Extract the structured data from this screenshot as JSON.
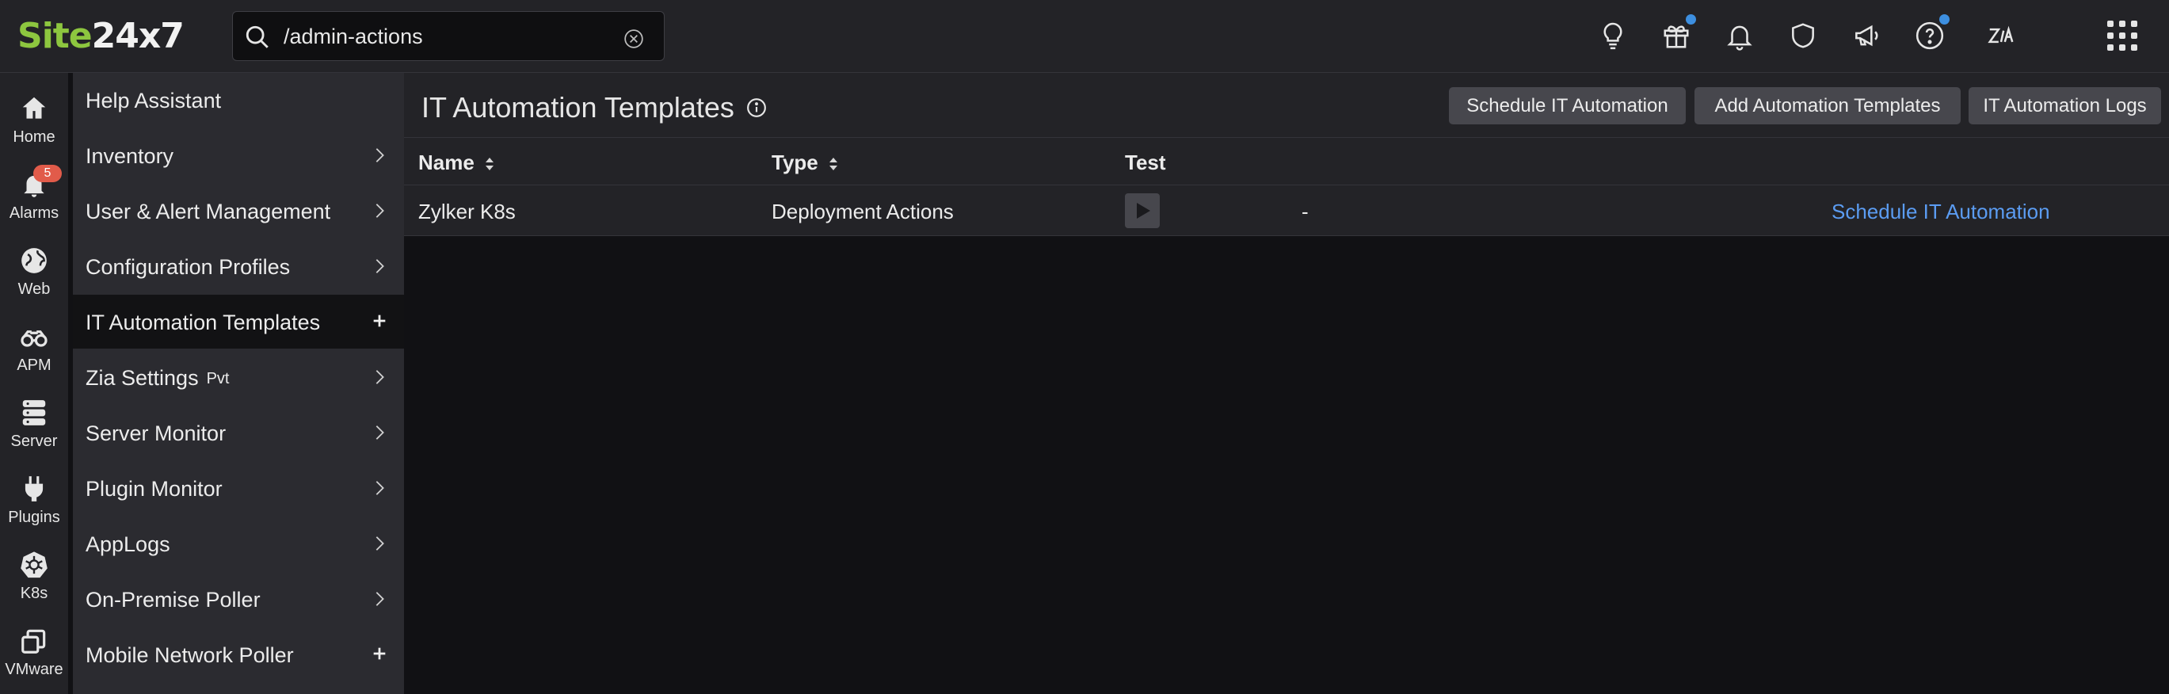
{
  "logo": {
    "part1": "Site",
    "part2": "24x7"
  },
  "search": {
    "value": "/admin-actions"
  },
  "topbar_icons": [
    "lightbulb-icon",
    "gift-icon",
    "bell-icon",
    "shield-icon",
    "megaphone-icon",
    "help-icon",
    "zia-icon",
    "apps-grid-icon"
  ],
  "rail": [
    {
      "label": "Home",
      "icon": "home-icon"
    },
    {
      "label": "Alarms",
      "icon": "alarm-bell-icon",
      "badge": "5"
    },
    {
      "label": "Web",
      "icon": "globe-icon"
    },
    {
      "label": "APM",
      "icon": "binoculars-icon"
    },
    {
      "label": "Server",
      "icon": "server-icon"
    },
    {
      "label": "Plugins",
      "icon": "plug-icon"
    },
    {
      "label": "K8s",
      "icon": "kubernetes-icon"
    },
    {
      "label": "VMware",
      "icon": "vmware-icon"
    }
  ],
  "menu": {
    "items": [
      {
        "label": "Help Assistant"
      },
      {
        "label": "Inventory"
      },
      {
        "label": "User & Alert Management"
      },
      {
        "label": "Configuration Profiles"
      },
      {
        "label": "IT Automation Templates"
      },
      {
        "label": "Zia Settings",
        "tag": "Pvt"
      },
      {
        "label": "Server Monitor"
      },
      {
        "label": "Plugin Monitor"
      },
      {
        "label": "AppLogs"
      },
      {
        "label": "On-Premise Poller"
      },
      {
        "label": "Mobile Network Poller"
      }
    ]
  },
  "page": {
    "title": "IT Automation Templates",
    "buttons": {
      "schedule": "Schedule IT Automation",
      "add": "Add Automation Templates",
      "logs": "IT Automation Logs"
    }
  },
  "table": {
    "columns": [
      "Name",
      "Type",
      "Test"
    ],
    "rows": [
      {
        "name": "Zylker K8s",
        "type": "Deployment Actions",
        "extra": "-",
        "action": "Schedule IT Automation"
      }
    ]
  },
  "colors": {
    "brand_green": "#8dc63f",
    "link_blue": "#5b9cf2",
    "badge_red": "#e15b4a",
    "dot_blue": "#3d8fe0"
  }
}
